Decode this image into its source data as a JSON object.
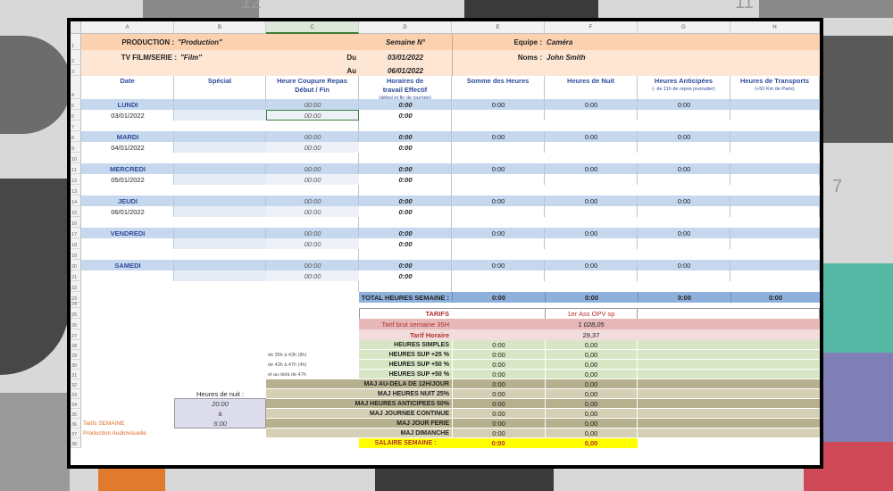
{
  "background": {
    "numbers": [
      "12",
      "11",
      "7"
    ]
  },
  "sheet": {
    "columns": [
      "A",
      "B",
      "C",
      "D",
      "E",
      "F",
      "G",
      "H"
    ],
    "rows": [
      "1",
      "2",
      "3",
      "4",
      "5",
      "6",
      "7",
      "8",
      "9",
      "10",
      "11",
      "12",
      "13",
      "14",
      "15",
      "16",
      "17",
      "18",
      "19",
      "20",
      "21",
      "22",
      "23",
      "24",
      "25",
      "26",
      "27",
      "28",
      "29",
      "30",
      "31",
      "32",
      "33",
      "34",
      "35",
      "36",
      "37",
      "38"
    ],
    "header": {
      "production_label": "PRODUCTION :",
      "production_value": "\"Production\"",
      "semaine_label": "Semaine N°",
      "equipe_label": "Equipe :",
      "equipe_value": "Caméra",
      "tvfilm_label": "TV FILM/SERIE :",
      "tvfilm_value": "\"Film\"",
      "du_label": "Du",
      "du_value": "03/01/2022",
      "au_label": "Au",
      "au_value": "06/01/2022",
      "noms_label": "Noms :",
      "noms_value": "John Smith"
    },
    "col_headers": {
      "date": "Date",
      "special": "Spécial",
      "coupure_1": "Heure Coupure Repas",
      "coupure_2": "Début / Fin",
      "horaires_1": "Horaires de",
      "horaires_2": "travail Effectif",
      "horaires_3": "(début et fin de journée)",
      "somme": "Somme des Heures",
      "nuit": "Heures de Nuit",
      "anticipees_1": "Heures Anticipées",
      "anticipees_2": "(- de 11h de repos journalier)",
      "transports_1": "Heures de Transports",
      "transports_2": "(+50 Km de Paris)"
    },
    "days": [
      {
        "name": "LUNDI",
        "date": "03/01/2022",
        "coupure1": "00:00",
        "coupure2": "00:00",
        "horaire1": "0:00",
        "horaire2": "0:00",
        "somme": "0:00",
        "nuit": "0:00",
        "anticipees": "0:00"
      },
      {
        "name": "MARDI",
        "date": "04/01/2022",
        "coupure1": "00:00",
        "coupure2": "00:00",
        "horaire1": "0:00",
        "horaire2": "0:00",
        "somme": "0:00",
        "nuit": "0:00",
        "anticipees": "0:00"
      },
      {
        "name": "MERCREDI",
        "date": "05/01/2022",
        "coupure1": "00:00",
        "coupure2": "00:00",
        "horaire1": "0:00",
        "horaire2": "0:00",
        "somme": "0:00",
        "nuit": "0:00",
        "anticipees": "0:00"
      },
      {
        "name": "JEUDI",
        "date": "06/01/2022",
        "coupure1": "00:00",
        "coupure2": "00:00",
        "horaire1": "0:00",
        "horaire2": "0:00",
        "somme": "0:00",
        "nuit": "0:00",
        "anticipees": "0:00"
      },
      {
        "name": "VENDREDI",
        "date": "",
        "coupure1": "00:00",
        "coupure2": "00:00",
        "horaire1": "0:00",
        "horaire2": "0:00",
        "somme": "0:00",
        "nuit": "0:00",
        "anticipees": "0:00"
      },
      {
        "name": "SAMEDI",
        "date": "",
        "coupure1": "00:00",
        "coupure2": "00:00",
        "horaire1": "0:00",
        "horaire2": "0:00",
        "somme": "0:00",
        "nuit": "0:00",
        "anticipees": "0:00"
      }
    ],
    "total": {
      "label": "TOTAL HEURES SEMAINE :",
      "somme": "0:00",
      "nuit": "0:00",
      "anticipees": "0:00",
      "transports": "0:00"
    },
    "tarifs": {
      "label": "TARIFS",
      "role": "1er Ass OPV sp",
      "brut_label": "Tarif brut semaine 35H",
      "brut_value": "1 028,05",
      "horaire_label": "Tarif Horaire",
      "horaire_value": "29,37"
    },
    "calc_rows": [
      {
        "note": "",
        "label": "HEURES SIMPLES",
        "hours": "0:00",
        "amount": "0,00",
        "tone": "green"
      },
      {
        "note": "de 35h à 43h (8h)",
        "label": "HEURES SUP +25 %",
        "hours": "0:00",
        "amount": "0,00",
        "tone": "green"
      },
      {
        "note": "de 43h à 47h (4h)",
        "label": "HEURES SUP +50 %",
        "hours": "0:00",
        "amount": "0,00",
        "tone": "green"
      },
      {
        "note": "et au-delà de 47h",
        "label": "HEURES SUP +50 %",
        "hours": "0:00",
        "amount": "0,00",
        "tone": "green"
      },
      {
        "note": "",
        "label": "MAJ AU-DELA DE 12H/JOUR",
        "hours": "0:00",
        "amount": "0,00",
        "tone": "olive"
      },
      {
        "note": "",
        "label": "MAJ HEURES NUIT 25%",
        "hours": "0:00",
        "amount": "0,00",
        "tone": "tan"
      },
      {
        "note": "",
        "label": "MAJ HEURES ANTICIPEES 50%",
        "hours": "0:00",
        "amount": "0,00",
        "tone": "olive"
      },
      {
        "note": "",
        "label": "MAJ JOURNEE CONTINUE",
        "hours": "0:00",
        "amount": "0,00",
        "tone": "tan"
      },
      {
        "note": "",
        "label": "MAJ JOUR FERIE",
        "hours": "0:00",
        "amount": "0,00",
        "tone": "olive"
      },
      {
        "note": "",
        "label": "MAJ DIMANCHE",
        "hours": "0:00",
        "amount": "0,00",
        "tone": "tan"
      }
    ],
    "salaire": {
      "label": "SALAIRE SEMAINE :",
      "hours": "0:00",
      "amount": "0,00"
    },
    "nuit_box": {
      "title": "Heures de nuit :",
      "start": "20:00",
      "sep": "à",
      "end": "6:00"
    },
    "footer": {
      "tarifs_semaine": "Tarifs SEMAINE",
      "production_av": "Production Audiovisuelle"
    },
    "colors": {
      "orange_band": "#fbd1b0",
      "blue_band": "#c6d8ee",
      "total_blue": "#8eb1dc",
      "tarif_red": "#e6b8b8",
      "green": "#d8e6c5",
      "olive": "#b6b08f",
      "tan": "#d4cfb5",
      "yellow": "#ffff00"
    }
  }
}
